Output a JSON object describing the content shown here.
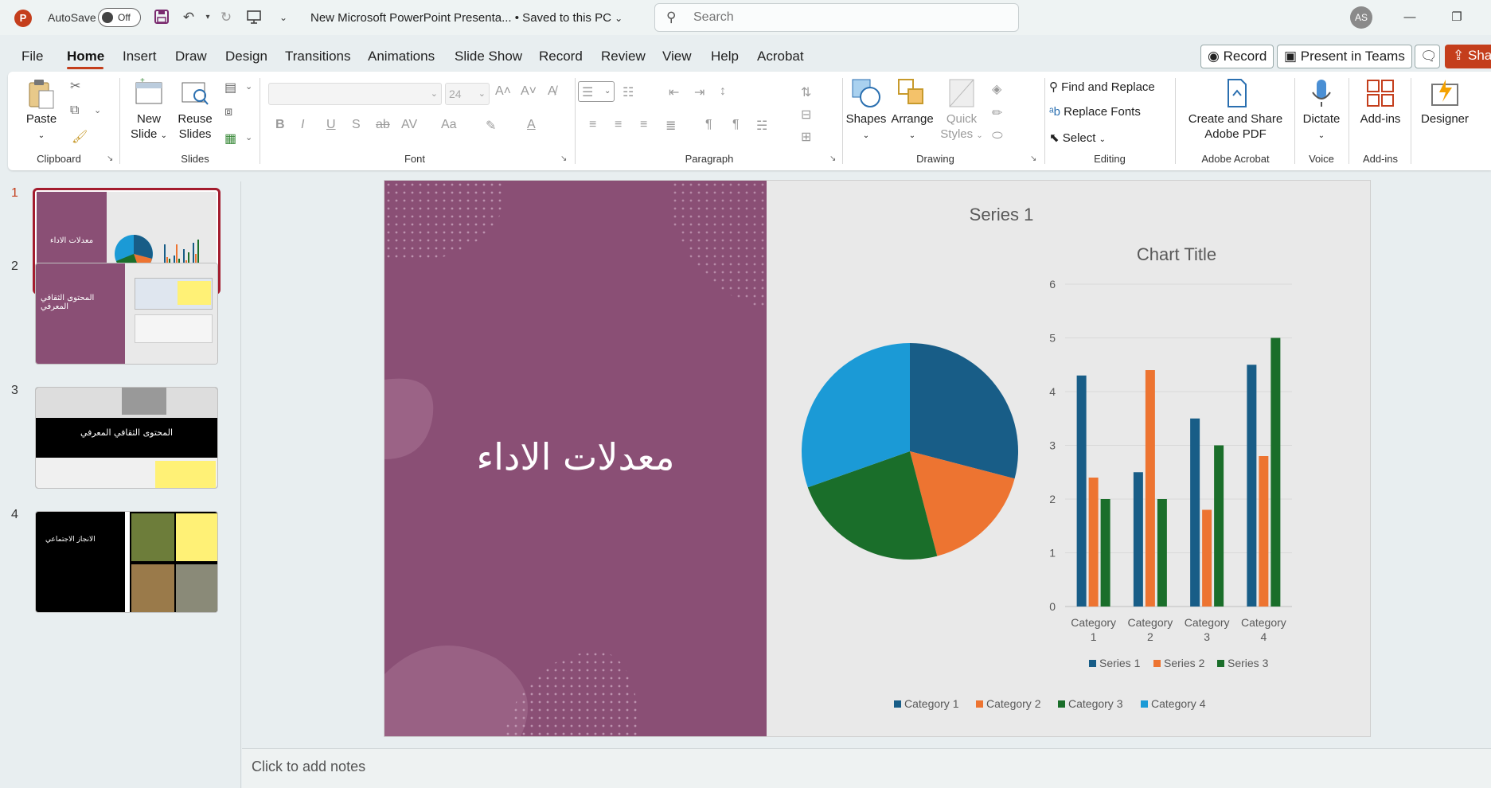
{
  "titlebar": {
    "app_letter": "P",
    "autosave_label": "AutoSave",
    "autosave_state": "Off",
    "document_title": "New Microsoft PowerPoint Presenta...  •  Saved to this PC",
    "search_placeholder": "Search",
    "user_initials": "AS"
  },
  "menu": {
    "tabs": [
      "File",
      "Home",
      "Insert",
      "Draw",
      "Design",
      "Transitions",
      "Animations",
      "Slide Show",
      "Record",
      "Review",
      "View",
      "Help",
      "Acrobat"
    ],
    "active_tab": "Home",
    "record_button": "Record",
    "present_button": "Present in Teams",
    "share_button": "Share"
  },
  "ribbon": {
    "groups": {
      "clipboard": "Clipboard",
      "slides": "Slides",
      "font": "Font",
      "paragraph": "Paragraph",
      "drawing": "Drawing",
      "editing": "Editing",
      "adobe": "Adobe Acrobat",
      "voice": "Voice",
      "addins": "Add-ins"
    },
    "paste": "Paste",
    "new_slide": [
      "New",
      "Slide"
    ],
    "reuse_slides": [
      "Reuse",
      "Slides"
    ],
    "font_size": "24",
    "shapes": "Shapes",
    "arrange": "Arrange",
    "quick_styles": [
      "Quick",
      "Styles"
    ],
    "find_replace": "Find and Replace",
    "replace_fonts": "Replace Fonts",
    "select": "Select",
    "create_share": [
      "Create and Share",
      "Adobe PDF"
    ],
    "dictate": "Dictate",
    "add_ins": "Add-ins",
    "designer": "Designer"
  },
  "thumbnails": [
    {
      "number": "1",
      "title": "معدلات الاداء",
      "active": true
    },
    {
      "number": "2",
      "title": "المحتوى الثقافي المعرفي",
      "active": false
    },
    {
      "number": "3",
      "title": "المحتوى الثقافي المعرفي",
      "active": false
    },
    {
      "number": "4",
      "title": "الانجاز الاجتماعي",
      "active": false
    }
  ],
  "slide": {
    "title": "معدلات الاداء"
  },
  "notes_placeholder": "Click to add notes",
  "colors": {
    "accent": "#c43e1c",
    "slide_purple": "#8a4f75",
    "series1": "#185d87",
    "series2": "#ed7431",
    "series3": "#1a6e2a",
    "series4": "#1b9ad6"
  },
  "chart_data": [
    {
      "type": "pie",
      "title": "Series 1",
      "categories": [
        "Category 1",
        "Category 2",
        "Category 3",
        "Category 4"
      ],
      "values": [
        4.3,
        2.5,
        3.5,
        4.5
      ],
      "legend": "bottom"
    },
    {
      "type": "bar",
      "title": "Chart Title",
      "categories": [
        "Category 1",
        "Category 2",
        "Category 3",
        "Category 4"
      ],
      "series": [
        {
          "name": "Series 1",
          "values": [
            4.3,
            2.5,
            3.5,
            4.5
          ]
        },
        {
          "name": "Series 2",
          "values": [
            2.4,
            4.4,
            1.8,
            2.8
          ]
        },
        {
          "name": "Series 3",
          "values": [
            2,
            2,
            3,
            5
          ]
        }
      ],
      "ylim": [
        0,
        6
      ],
      "yticks": [
        0,
        1,
        2,
        3,
        4,
        5,
        6
      ],
      "grid": true,
      "legend": "bottom"
    }
  ]
}
